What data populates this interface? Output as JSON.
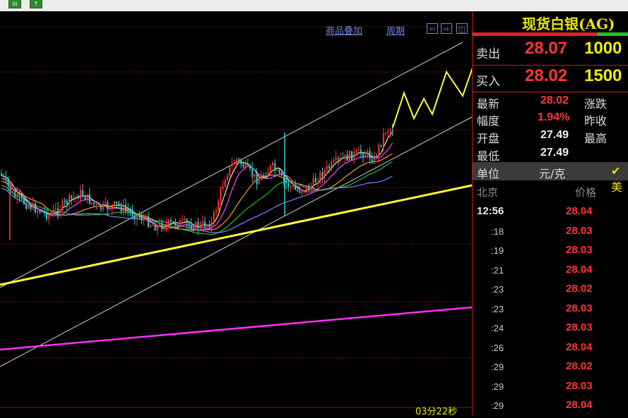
{
  "toolbar": {
    "btn1": "iii",
    "btn2": "↑"
  },
  "chart": {
    "links": {
      "overlay": "商品叠加",
      "period": "周期"
    },
    "nav": {
      "prev": "⇦",
      "next": "⇨",
      "layout": "◫"
    },
    "timer": "03分22秒",
    "colors": {
      "up": "#ff3535",
      "down": "#2ad4d4",
      "ma1": "#f0f0a0",
      "ma2": "#ff40ff",
      "ma3": "#20c020",
      "ma4": "#ff9a30",
      "ma5": "#8080ff",
      "trendline": "#ffff30",
      "support": "#ff30ff",
      "channel": "#d0d0d0",
      "grid": "#7a1818"
    }
  },
  "panel": {
    "title": "现货白银(AG)",
    "sell": {
      "label": "卖出",
      "price": "28.07",
      "volume": "1000"
    },
    "buy": {
      "label": "买入",
      "price": "28.02",
      "volume": "1500"
    },
    "stats": {
      "latest": {
        "label": "最新",
        "value": "28.02"
      },
      "change": {
        "label": "涨跌"
      },
      "amplitude": {
        "label": "幅度",
        "value": "1.94%"
      },
      "prev_close": {
        "label": "昨收"
      },
      "open": {
        "label": "开盘",
        "value": "27.49"
      },
      "high": {
        "label": "最高"
      },
      "low": {
        "label": "最低",
        "value": "27.49"
      }
    },
    "unit": {
      "label": "单位",
      "value": "元/克",
      "extra": "✔ 美"
    },
    "ticks_header": {
      "place": "北京",
      "price": "价格"
    },
    "ticks": [
      {
        "time": "12:56",
        "price": "28.04"
      },
      {
        "time": ":18",
        "price": "28.03"
      },
      {
        "time": ":19",
        "price": "28.03"
      },
      {
        "time": ":21",
        "price": "28.04"
      },
      {
        "time": ":23",
        "price": "28.02"
      },
      {
        "time": ":23",
        "price": "28.03"
      },
      {
        "time": ":24",
        "price": "28.03"
      },
      {
        "time": ":26",
        "price": "28.04"
      },
      {
        "time": ":29",
        "price": "28.02"
      },
      {
        "time": ":29",
        "price": "28.03"
      },
      {
        "time": ":29",
        "price": "28.04"
      }
    ]
  }
}
